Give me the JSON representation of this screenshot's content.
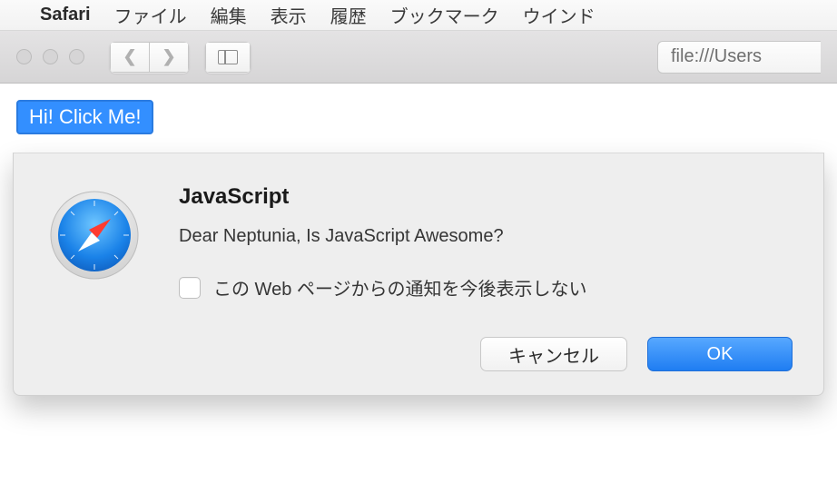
{
  "menubar": {
    "app": "Safari",
    "items": [
      "ファイル",
      "編集",
      "表示",
      "履歴",
      "ブックマーク",
      "ウインド"
    ]
  },
  "toolbar": {
    "address": "file:///Users"
  },
  "page": {
    "hi_button": "Hi! Click Me!"
  },
  "dialog": {
    "title": "JavaScript",
    "message": "Dear Neptunia, Is JavaScript Awesome?",
    "suppress_label": "この Web ページからの通知を今後表示しない",
    "cancel": "キャンセル",
    "ok": "OK"
  }
}
